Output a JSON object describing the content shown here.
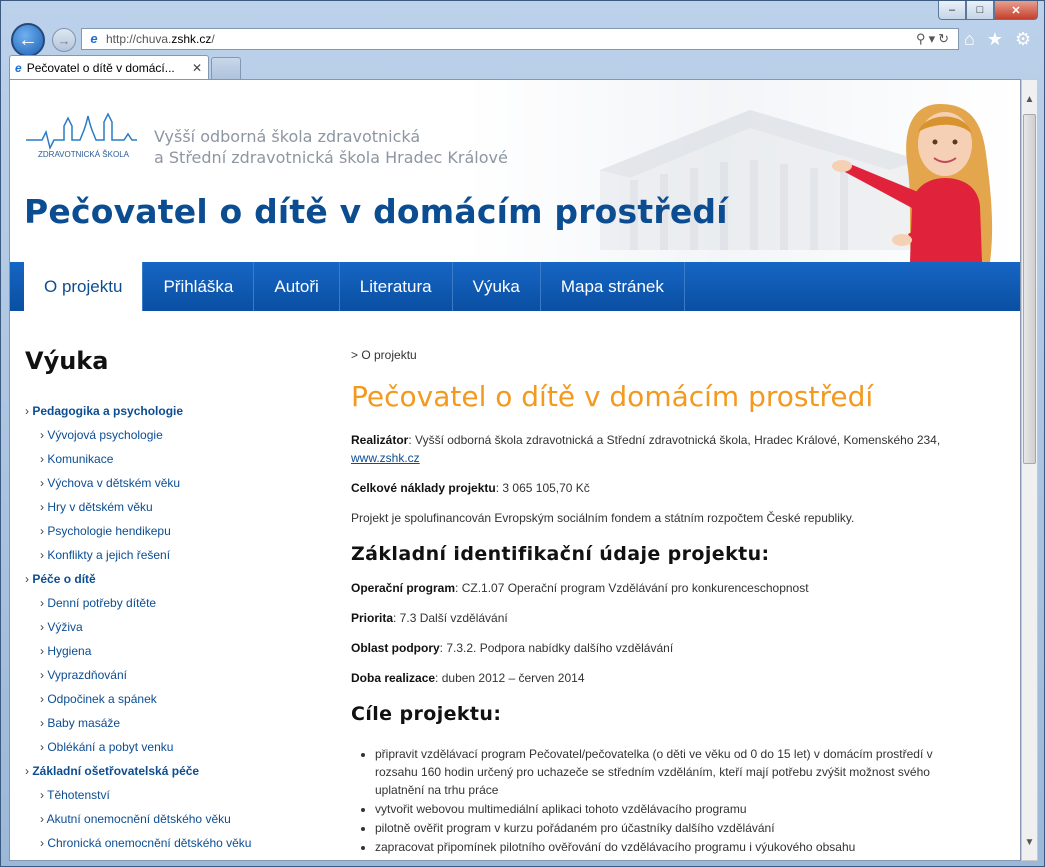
{
  "browser": {
    "url_prefix": "http://chuva.",
    "url_host": "zshk.cz",
    "url_suffix": "/",
    "tab_title": "Pečovatel o dítě v domácí...",
    "window_buttons": {
      "minimize": "–",
      "maximize": "□",
      "close": "✕"
    }
  },
  "header": {
    "logo_text": "ZDRAVOTNICKÁ ŠKOLA",
    "school_line1": "Vyšší odborná škola zdravotnická",
    "school_line2": "a Střední zdravotnická škola Hradec Králové",
    "site_title": "Pečovatel o dítě v domácím prostředí"
  },
  "nav": [
    "O projektu",
    "Přihláška",
    "Autoři",
    "Literatura",
    "Výuka",
    "Mapa stránek"
  ],
  "sidebar": {
    "title": "Výuka",
    "categories": [
      {
        "label": "Pedagogika a psychologie",
        "items": [
          "Vývojová psychologie",
          "Komunikace",
          "Výchova v dětském věku",
          "Hry v dětském věku",
          "Psychologie hendikepu",
          "Konflikty a jejich řešení"
        ]
      },
      {
        "label": "Péče o dítě",
        "items": [
          "Denní potřeby dítěte",
          "Výživa",
          "Hygiena",
          "Vyprazdňování",
          "Odpočinek a spánek",
          "Baby masáže",
          "Oblékání a pobyt venku"
        ]
      },
      {
        "label": "Základní ošetřovatelská péče",
        "items": [
          "Těhotenství",
          "Akutní onemocnění dětského věku",
          "Chronická onemocnění dětského věku"
        ]
      }
    ]
  },
  "main": {
    "breadcrumb": "> O projektu",
    "title": "Pečovatel o dítě v domácím prostředí",
    "realizator_label": "Realizátor",
    "realizator_value": ": Vyšší odborná škola zdravotnická a Střední zdravotnická škola, Hradec Králové, Komenského 234,",
    "realizator_link": "www.zshk.cz",
    "costs_label": "Celkové náklady projektu",
    "costs_value": ": 3 065 105,70 Kč",
    "funding_text": "Projekt je spolufinancován Evropským sociálním fondem a státním rozpočtem České republiky.",
    "id_heading": "Základní identifikační údaje projektu:",
    "id_rows": [
      {
        "label": "Operační program",
        "value": ": CZ.1.07 Operační program Vzdělávání pro konkurenceschopnost"
      },
      {
        "label": "Priorita",
        "value": ": 7.3 Další vzdělávání"
      },
      {
        "label": "Oblast podpory",
        "value": ": 7.3.2. Podpora nabídky dalšího vzdělávání"
      },
      {
        "label": "Doba realizace",
        "value": ": duben 2012 – červen 2014"
      }
    ],
    "goals_heading": "Cíle projektu:",
    "goals": [
      "připravit vzdělávací program Pečovatel/pečovatelka (o děti ve věku od 0 do 15 let) v domácím prostředí v rozsahu 160 hodin určený pro uchazeče se středním vzděláním, kteří mají potřebu zvýšit možnost svého uplatnění na trhu práce",
      "vytvořit webovou multimediální aplikaci tohoto vzdělávacího programu",
      "pilotně ověřit program v kurzu pořádaném pro účastníky dalšího vzdělávání",
      "zapracovat připomínek pilotního ověřování do vzdělávacího programu i výukového obsahu"
    ]
  }
}
